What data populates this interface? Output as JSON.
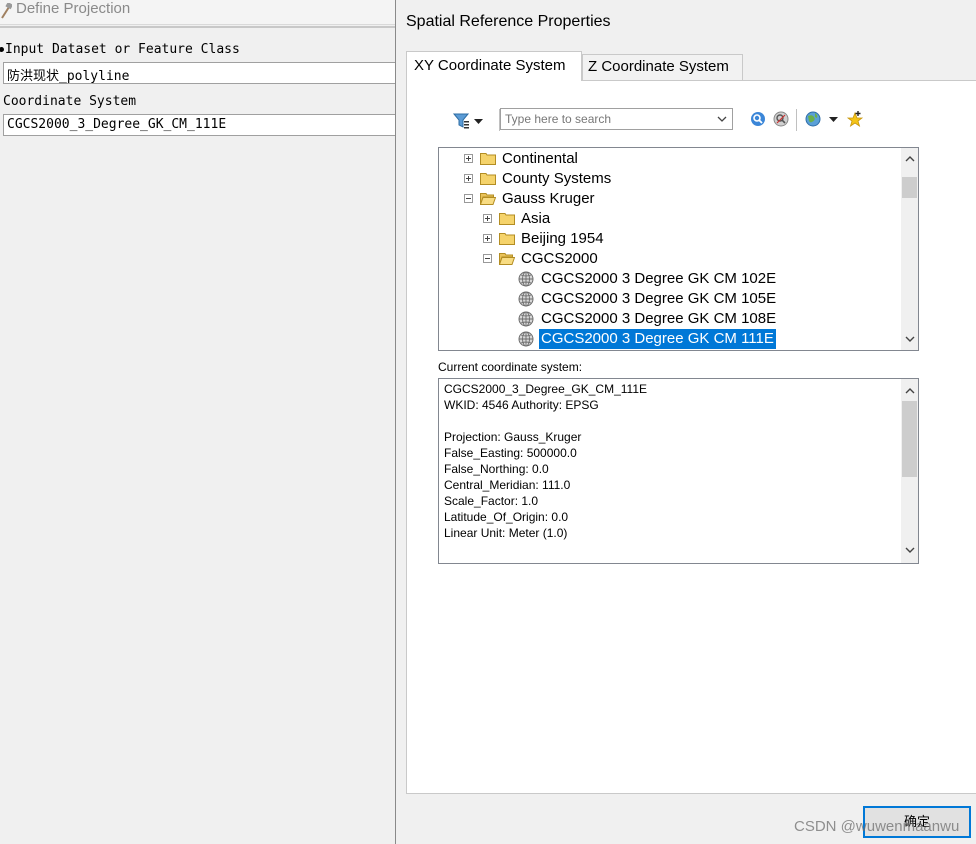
{
  "define_projection": {
    "title": "Define Projection",
    "input_label": "Input Dataset or Feature Class",
    "input_value": "防洪现状_polyline",
    "cs_label": "Coordinate System",
    "cs_value": "CGCS2000_3_Degree_GK_CM_111E"
  },
  "spatial_ref": {
    "title": "Spatial Reference Properties",
    "tabs": [
      {
        "label": "XY Coordinate System",
        "active": true
      },
      {
        "label": "Z Coordinate System",
        "active": false
      }
    ],
    "search_placeholder": "Type here to search",
    "tree": [
      {
        "label": "Continental",
        "type": "folder",
        "expander": "plus"
      },
      {
        "label": "County Systems",
        "type": "folder",
        "expander": "plus"
      },
      {
        "label": "Gauss Kruger",
        "type": "folder-open",
        "expander": "minus"
      },
      {
        "label": "Asia",
        "type": "folder",
        "expander": "plus"
      },
      {
        "label": "Beijing 1954",
        "type": "folder",
        "expander": "plus"
      },
      {
        "label": "CGCS2000",
        "type": "folder-open",
        "expander": "minus"
      },
      {
        "label": "CGCS2000 3 Degree GK CM 102E",
        "type": "globe"
      },
      {
        "label": "CGCS2000 3 Degree GK CM 105E",
        "type": "globe"
      },
      {
        "label": "CGCS2000 3 Degree GK CM 108E",
        "type": "globe"
      },
      {
        "label": "CGCS2000 3 Degree GK CM 111E",
        "type": "globe",
        "selected": true
      }
    ],
    "current_label": "Current coordinate system:",
    "current_lines": [
      "CGCS2000_3_Degree_GK_CM_111E",
      "WKID: 4546 Authority: EPSG",
      "",
      "Projection: Gauss_Kruger",
      "False_Easting: 500000.0",
      "False_Northing: 0.0",
      "Central_Meridian: 111.0",
      "Scale_Factor: 1.0",
      "Latitude_Of_Origin: 0.0",
      "Linear Unit: Meter (1.0)"
    ],
    "ok_label": "确定",
    "selection_color": "#0078d7"
  },
  "watermark": "CSDN @wuwenmaanwu"
}
